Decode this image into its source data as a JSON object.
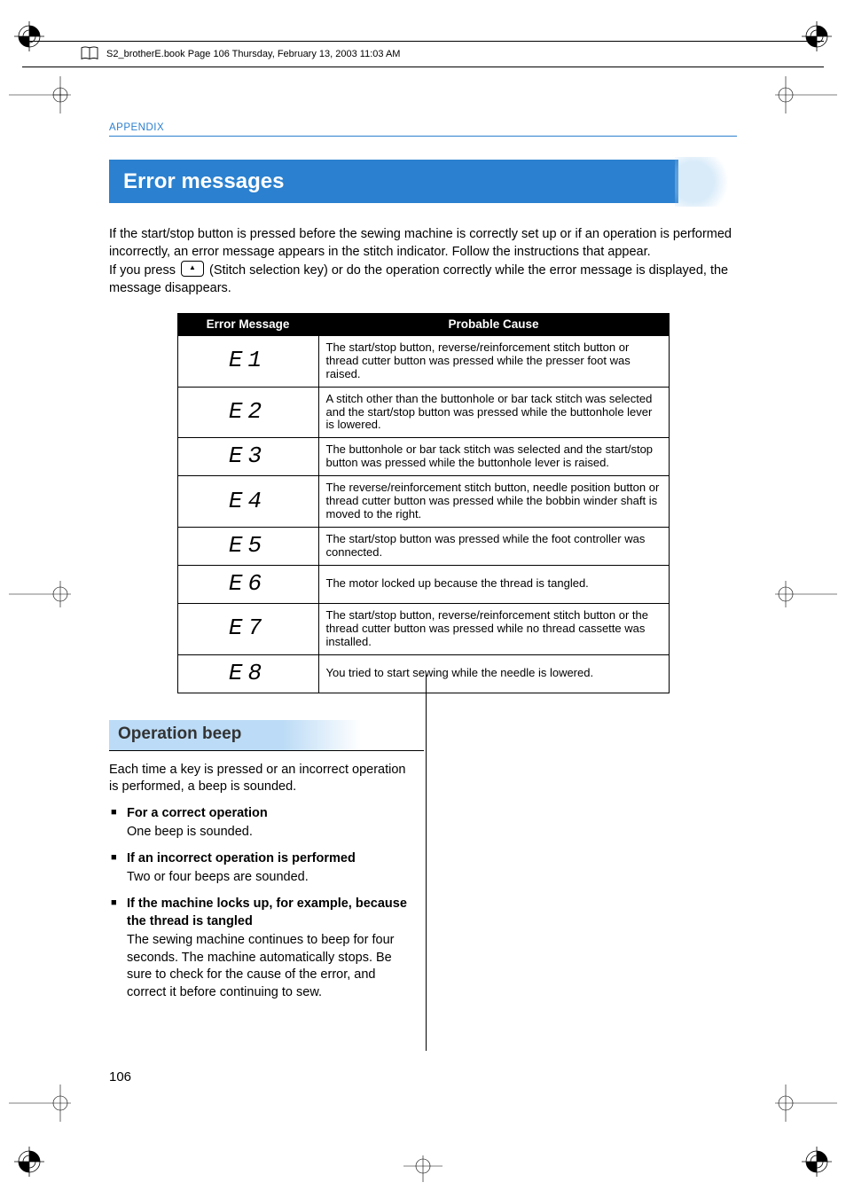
{
  "meta_header": "S2_brotherE.book  Page 106  Thursday, February 13, 2003  11:03 AM",
  "appendix_label": "APPENDIX",
  "section_title": "Error messages",
  "intro": {
    "p1": "If the start/stop button is pressed before the sewing machine is correctly set up or if an operation is performed incorrectly, an error message appears in the stitch indicator. Follow the instructions that appear.",
    "p2a": "If you press ",
    "p2b": " (Stitch selection key) or do the operation correctly while the error message is displayed, the message disappears."
  },
  "table": {
    "head_code": "Error Message",
    "head_cause": "Probable Cause",
    "rows": [
      {
        "code": "E1",
        "cause": "The start/stop button, reverse/reinforcement stitch button or thread cutter button was pressed while the presser foot was raised."
      },
      {
        "code": "E2",
        "cause": "A stitch other than the buttonhole or bar tack stitch was selected and the start/stop button was pressed while the buttonhole lever is lowered."
      },
      {
        "code": "E3",
        "cause": "The buttonhole or bar tack stitch was selected and the start/stop button was pressed while the buttonhole lever is raised."
      },
      {
        "code": "E4",
        "cause": "The reverse/reinforcement stitch button, needle position button or thread cutter button was pressed while the bobbin winder shaft is moved to the right."
      },
      {
        "code": "E5",
        "cause": "The start/stop button was pressed while the foot controller was connected."
      },
      {
        "code": "E6",
        "cause": "The motor locked up because the thread is tangled."
      },
      {
        "code": "E7",
        "cause": "The start/stop button, reverse/reinforcement stitch button or the thread cutter button was pressed while no thread cassette was installed."
      },
      {
        "code": "E8",
        "cause": "You tried to start sewing while the needle is lowered."
      }
    ]
  },
  "subsection": {
    "title": "Operation beep",
    "intro": "Each time a key is pressed or an incorrect operation is performed, a beep is sounded.",
    "items": [
      {
        "bold": "For a correct operation",
        "desc": "One beep is sounded."
      },
      {
        "bold": "If an incorrect operation is performed",
        "desc": "Two or four beeps are sounded."
      },
      {
        "bold": "If the machine locks up, for example, because the thread is tangled",
        "desc": "The sewing machine continues to beep for four seconds. The machine automatically stops. Be sure to check for the cause of the error, and correct it before continuing to sew."
      }
    ]
  },
  "page_number": "106"
}
